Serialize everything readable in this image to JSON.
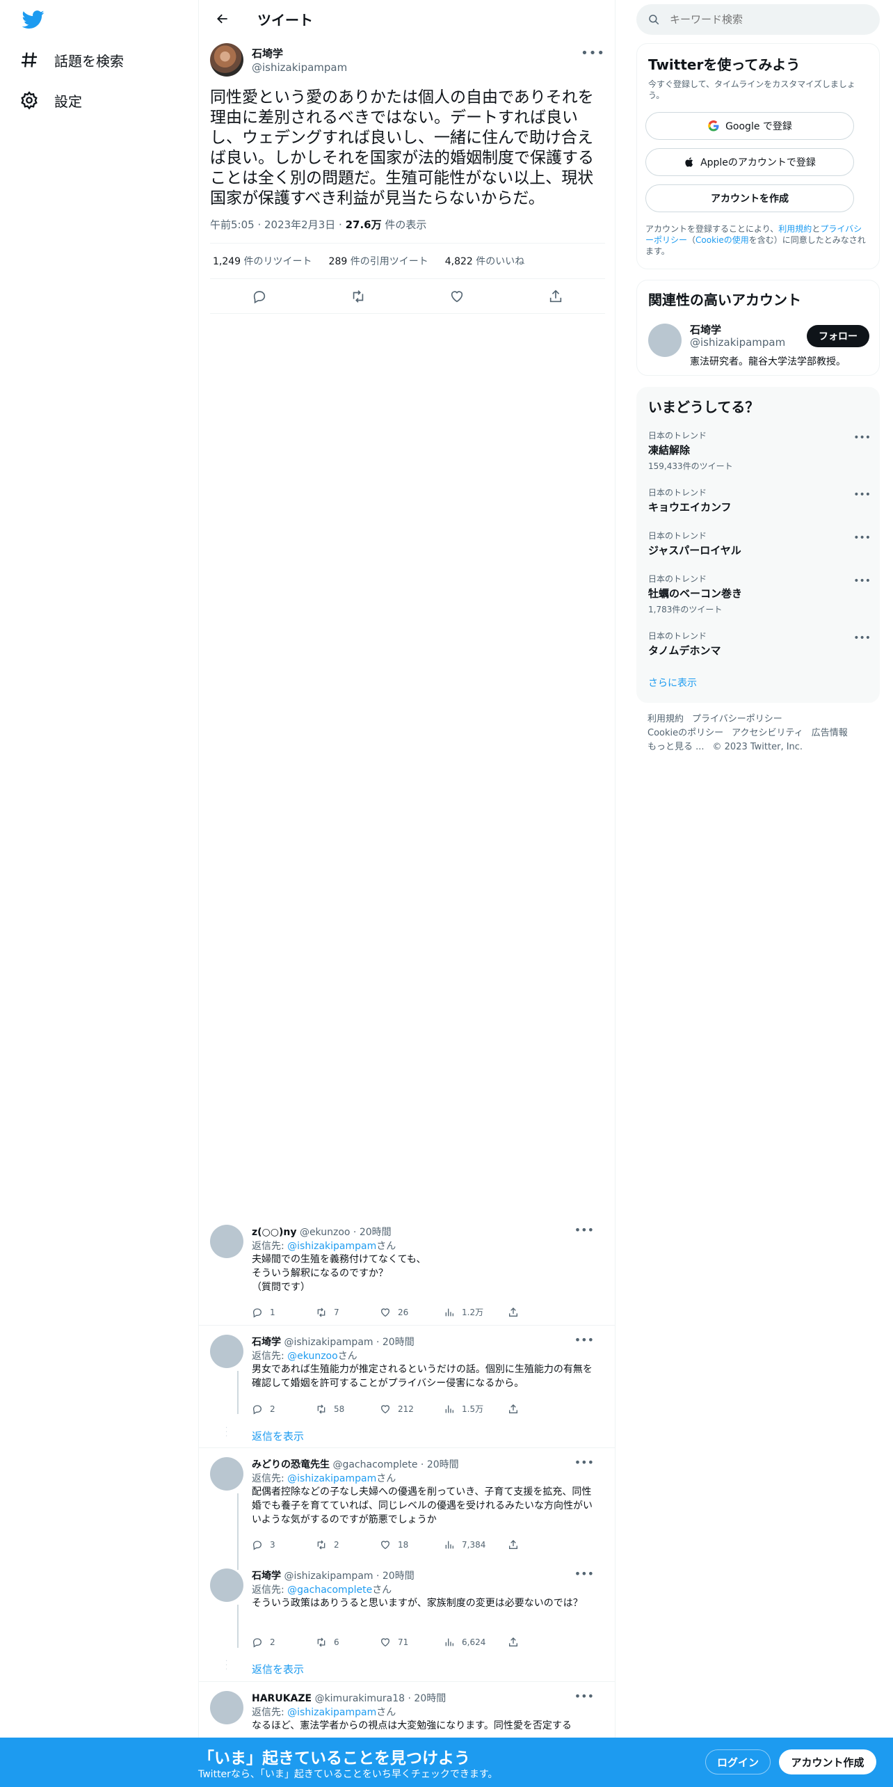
{
  "nav": {
    "explore_label": "話題を検索",
    "settings_label": "設定"
  },
  "header": {
    "title": "ツイート"
  },
  "tweet": {
    "name": "石埼学",
    "handle": "@ishizakipampam",
    "text": "同性愛という愛のありかたは個人の自由でありそれを理由に差別されるべきではない。デートすれば良いし、ウェデングすれば良いし、一緒に住んで助け合えば良い。しかしそれを国家が法的婚姻制度で保護することは全く別の問題だ。生殖可能性がない以上、現状国家が保護すべき利益が見当たらないからだ。",
    "time": "午前5:05",
    "date": "2023年2月3日",
    "views_count": "27.6万",
    "views_label": " 件の表示",
    "retweets_count": "1,249",
    "retweets_label": " 件のリツイート",
    "quotes_count": "289",
    "quotes_label": " 件の引用ツイート",
    "likes_count": "4,822",
    "likes_label": " 件のいいね"
  },
  "replies": [
    {
      "name": "z(○○)ny",
      "handle": "@ekunzoo",
      "age": "20時間",
      "reply_prefix": "返信先: ",
      "reply_to": "@ishizakipampam",
      "reply_suffix": "さん",
      "body": "夫婦間での生殖を義務付けてなくても、\nそういう解釈になるのですか？\n（質問です）",
      "comments": "1",
      "retweets": "7",
      "likes": "26",
      "views": "1.2万"
    },
    {
      "name": "石埼学",
      "handle": "@ishizakipampam",
      "age": "20時間",
      "reply_prefix": "返信先: ",
      "reply_to": "@ekunzoo",
      "reply_suffix": "さん",
      "body": "男女であれば生殖能力が推定されるというだけの話。個別に生殖能力の有無を確認して婚姻を許可することがプライバシー侵害になるから。",
      "comments": "2",
      "retweets": "58",
      "likes": "212",
      "views": "1.5万"
    },
    {
      "name": "みどりの恐竜先生",
      "handle": "@gachacomplete",
      "age": "20時間",
      "reply_prefix": "返信先: ",
      "reply_to": "@ishizakipampam",
      "reply_suffix": "さん",
      "body": "配偶者控除などの子なし夫婦への優遇を削っていき、子育て支援を拡充、同性婚でも養子を育てていれば、同じレベルの優遇を受けれるみたいな方向性がいいような気がするのですが筋悪でしょうか",
      "comments": "3",
      "retweets": "2",
      "likes": "18",
      "views": "7,384"
    },
    {
      "name": "石埼学",
      "handle": "@ishizakipampam",
      "age": "20時間",
      "reply_prefix": "返信先: ",
      "reply_to": "@gachacomplete",
      "reply_suffix": "さん",
      "body": "そういう政策はありうると思いますが、家族制度の変更は必要ないのでは？",
      "comments": "2",
      "retweets": "6",
      "likes": "71",
      "views": "6,624"
    },
    {
      "name": "HARUKAZE",
      "handle": "@kimurakimura18",
      "age": "20時間",
      "reply_prefix": "返信先: ",
      "reply_to": "@ishizakipampam",
      "reply_suffix": "さん",
      "body": "なるほど、憲法学者からの視点は大変勉強になります。同性愛を否定する"
    }
  ],
  "show_replies_label": "返信を表示",
  "search": {
    "placeholder": "キーワード検索"
  },
  "signup_card": {
    "title": "Twitterを使ってみよう",
    "subtitle": "今すぐ登録して、タイムラインをカスタマイズしましょう。",
    "google_label": "Google で登録",
    "apple_label": "Appleのアカウントで登録",
    "create_label": "アカウントを作成",
    "legal_prefix": "アカウントを登録することにより、",
    "legal_terms": "利用規約",
    "legal_and": "と",
    "legal_privacy": "プライバシーポリシー",
    "legal_paren_open": "（",
    "legal_cookie": "Cookieの使用",
    "legal_suffix": "を含む）に同意したとみなされます。"
  },
  "related": {
    "title": "関連性の高いアカウント",
    "name": "石埼学",
    "handle": "@ishizakipampam",
    "bio": "憲法研究者。龍谷大学法学部教授。",
    "follow_label": "フォロー"
  },
  "trends": {
    "title": "いまどうしてる？",
    "items": [
      {
        "category": "日本のトレンド",
        "name": "凍結解除",
        "count": "159,433件のツイート"
      },
      {
        "category": "日本のトレンド",
        "name": "キョウエイカンフ",
        "count": ""
      },
      {
        "category": "日本のトレンド",
        "name": "ジャスパーロイヤル",
        "count": ""
      },
      {
        "category": "日本のトレンド",
        "name": "牡蠣のベーコン巻き",
        "count": "1,783件のツイート"
      },
      {
        "category": "日本のトレンド",
        "name": "タノムデホンマ",
        "count": ""
      }
    ],
    "show_more_label": "さらに表示"
  },
  "footer": {
    "terms": "利用規約",
    "privacy": "プライバシーポリシー",
    "cookie": "Cookieのポリシー",
    "accessibility": "アクセシビリティ",
    "ads": "広告情報",
    "more": "もっと見る ...",
    "copyright": "© 2023 Twitter, Inc."
  },
  "bottom_bar": {
    "title": "「いま」起きていることを見つけよう",
    "subtitle": "Twitterなら、「いま」起きていることをいち早くチェックできます。",
    "login_label": "ログイン",
    "signup_label": "アカウント作成"
  },
  "colors": {
    "accent": "#1d9bf0",
    "text": "#0f1419",
    "muted": "#536471",
    "border": "#eff3f4"
  }
}
